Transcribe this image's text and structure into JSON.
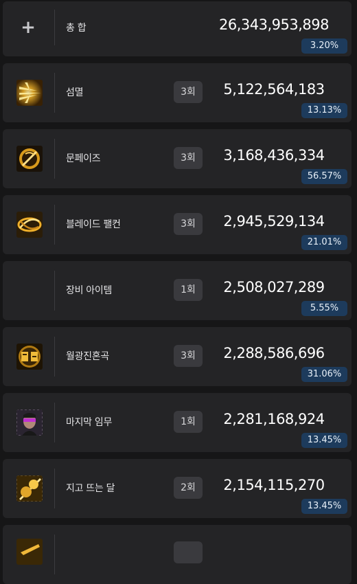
{
  "total": {
    "label": "총 합",
    "value": "26,343,953,898",
    "percent": "3.20%",
    "icon": "plus-icon"
  },
  "skills": [
    {
      "name": "섬멸",
      "count": "3회",
      "value": "5,122,564,183",
      "percent": "13.13%",
      "icon": "annihilation-skill-icon"
    },
    {
      "name": "문페이즈",
      "count": "3회",
      "value": "3,168,436,334",
      "percent": "56.57%",
      "icon": "moon-phase-skill-icon"
    },
    {
      "name": "블레이드 팰컨",
      "count": "3회",
      "value": "2,945,529,134",
      "percent": "21.01%",
      "icon": "blade-falcon-skill-icon"
    },
    {
      "name": "장비 아이템",
      "count": "1회",
      "value": "2,508,027,289",
      "percent": "5.55%",
      "icon": ""
    },
    {
      "name": "월광진혼곡",
      "count": "3회",
      "value": "2,288,586,696",
      "percent": "31.06%",
      "icon": "moonlight-requiem-skill-icon"
    },
    {
      "name": "마지막 임무",
      "count": "1회",
      "value": "2,281,168,924",
      "percent": "13.45%",
      "icon": "last-mission-skill-icon"
    },
    {
      "name": "지고 뜨는 달",
      "count": "2회",
      "value": "2,154,115,270",
      "percent": "13.45%",
      "icon": "setting-rising-moon-skill-icon"
    },
    {
      "name": "",
      "count": "",
      "value": "",
      "percent": "",
      "icon": "partial-skill-icon"
    }
  ],
  "colors": {
    "background": "#161617",
    "card": "#242426",
    "count_badge": "#3a3a3e",
    "percent_badge": "#1d3b5c",
    "gold": "#e0a52a"
  }
}
